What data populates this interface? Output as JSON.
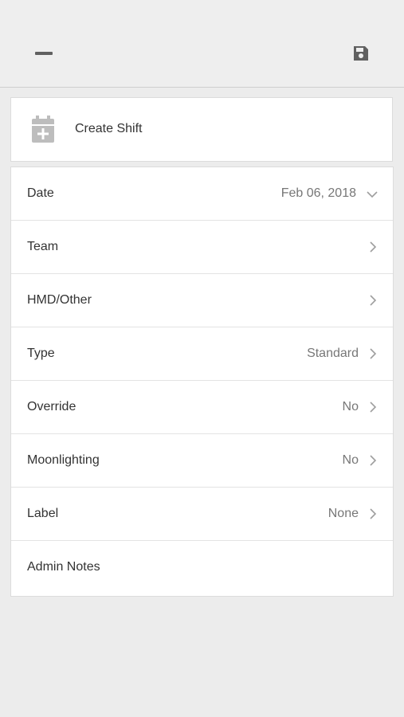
{
  "header": {
    "collapse_icon": "minus-icon",
    "save_icon": "save-icon"
  },
  "create_card": {
    "icon": "calendar-add-icon",
    "title": "Create Shift"
  },
  "form": {
    "rows": [
      {
        "label": "Date",
        "value": "Feb 06, 2018",
        "indicator": "chevron-down-icon"
      },
      {
        "label": "Team",
        "value": "",
        "indicator": "chevron-right-icon"
      },
      {
        "label": "HMD/Other",
        "value": "",
        "indicator": "chevron-right-icon"
      },
      {
        "label": "Type",
        "value": "Standard",
        "indicator": "chevron-right-icon"
      },
      {
        "label": "Override",
        "value": "No",
        "indicator": "chevron-right-icon"
      },
      {
        "label": "Moonlighting",
        "value": "No",
        "indicator": "chevron-right-icon"
      },
      {
        "label": "Label",
        "value": "None",
        "indicator": "chevron-right-icon"
      },
      {
        "label": "Admin Notes",
        "value": "",
        "indicator": ""
      }
    ]
  },
  "colors": {
    "background": "#ececec",
    "card": "#ffffff",
    "icon_gray": "#bdbdbd",
    "toolbar_icon": "#606060",
    "value_text": "#777777"
  }
}
